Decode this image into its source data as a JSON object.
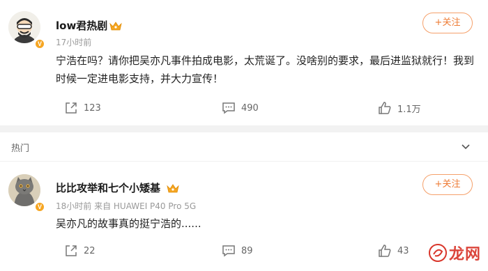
{
  "post1": {
    "username": "low君热剧",
    "time": "17小时前",
    "follow_label": "+关注",
    "content": "宁浩在吗？请你把吴亦凡事件拍成电影，太荒诞了。没啥别的要求，最后进监狱就行！我到时候一定进电影支持，并大力宣传！",
    "shares": "123",
    "comments": "490",
    "likes": "1.1万"
  },
  "hot_section": {
    "label": "热门"
  },
  "post2": {
    "username": "比比攻举和七个小矮基",
    "meta": "18小时前 来自 HUAWEI P40 Pro 5G",
    "follow_label": "+关注",
    "content": "吴亦凡的故事真的挺宁浩的......",
    "shares": "22",
    "comments": "89",
    "likes": "43"
  },
  "watermark": {
    "text": "龙网"
  },
  "colors": {
    "accent": "#ee7b34",
    "badge": "#f6a623",
    "watermark": "#d9362b"
  }
}
